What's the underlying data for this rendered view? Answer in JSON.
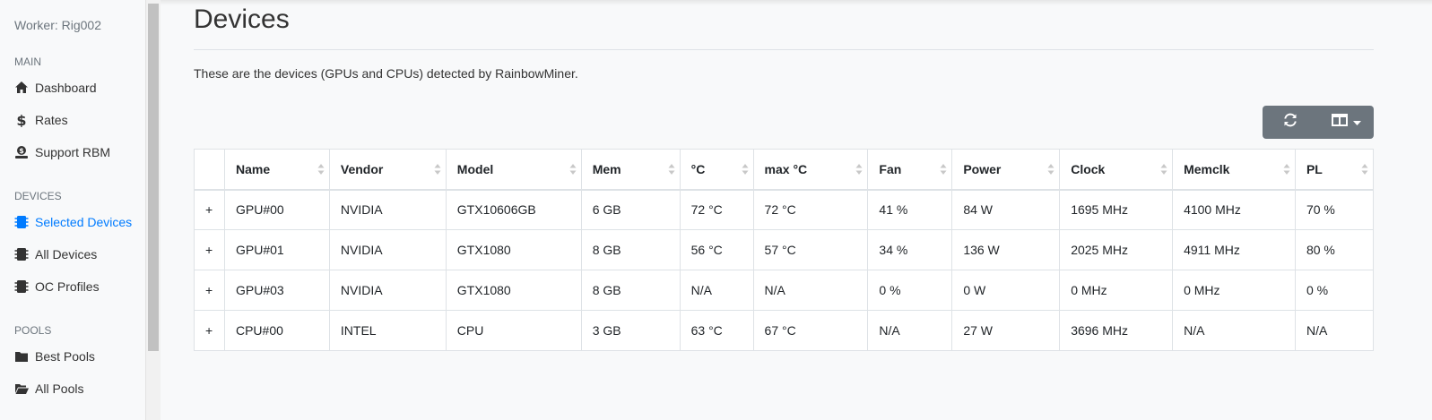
{
  "sidebar": {
    "worker": "Worker: Rig002",
    "sections": [
      {
        "heading": "MAIN",
        "items": [
          {
            "label": "Dashboard",
            "icon": "home-icon"
          },
          {
            "label": "Rates",
            "icon": "dollar-icon"
          },
          {
            "label": "Support RBM",
            "icon": "donate-icon"
          }
        ]
      },
      {
        "heading": "DEVICES",
        "items": [
          {
            "label": "Selected Devices",
            "icon": "chip-icon",
            "active": true
          },
          {
            "label": "All Devices",
            "icon": "chip-icon"
          },
          {
            "label": "OC Profiles",
            "icon": "chip-icon"
          }
        ]
      },
      {
        "heading": "POOLS",
        "items": [
          {
            "label": "Best Pools",
            "icon": "folder-icon"
          },
          {
            "label": "All Pools",
            "icon": "folder-open-icon"
          }
        ]
      }
    ]
  },
  "page": {
    "title": "Devices",
    "description": "These are the devices (GPUs and CPUs) detected by RainbowMiner."
  },
  "toolbar": {
    "refresh_icon": "refresh-icon",
    "columns_icon": "columns-icon"
  },
  "table": {
    "columns": [
      "Name",
      "Vendor",
      "Model",
      "Mem",
      "°C",
      "max °C",
      "Fan",
      "Power",
      "Clock",
      "Memclk",
      "PL"
    ],
    "rows": [
      {
        "expand": "+",
        "cells": [
          "GPU#00",
          "NVIDIA",
          "GTX10606GB",
          "6 GB",
          "72 °C",
          "72 °C",
          "41 %",
          "84 W",
          "1695 MHz",
          "4100 MHz",
          "70 %"
        ]
      },
      {
        "expand": "+",
        "cells": [
          "GPU#01",
          "NVIDIA",
          "GTX1080",
          "8 GB",
          "56 °C",
          "57 °C",
          "34 %",
          "136 W",
          "2025 MHz",
          "4911 MHz",
          "80 %"
        ]
      },
      {
        "expand": "+",
        "cells": [
          "GPU#03",
          "NVIDIA",
          "GTX1080",
          "8 GB",
          "N/A",
          "N/A",
          "0 %",
          "0 W",
          "0 MHz",
          "0 MHz",
          "0 %"
        ]
      },
      {
        "expand": "+",
        "cells": [
          "CPU#00",
          "INTEL",
          "CPU",
          "3 GB",
          "63 °C",
          "67 °C",
          "N/A",
          "27 W",
          "3696 MHz",
          "N/A",
          "N/A"
        ]
      }
    ]
  },
  "colors": {
    "accent": "#007bff",
    "toolbar_bg": "#6c757d"
  }
}
